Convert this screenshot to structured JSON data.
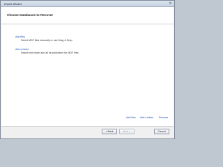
{
  "window": {
    "title": "Import Wizard",
    "close_glyph": "✕"
  },
  "header": {
    "title": "Choose Databases to Recover"
  },
  "options": [
    {
      "link": "Add files",
      "description": "Select MDF files manually or use Drag & Drop."
    },
    {
      "link": "Add a folder",
      "description": "Search the folder and all its subfolders for MDF files."
    }
  ],
  "actions": {
    "add_files": "Add files",
    "add_folder": "Add a folder",
    "remove": "Remove"
  },
  "buttons": {
    "back": "< Back",
    "next": "Next >",
    "cancel": "Cancel"
  },
  "icons": {
    "close": "close-icon"
  }
}
